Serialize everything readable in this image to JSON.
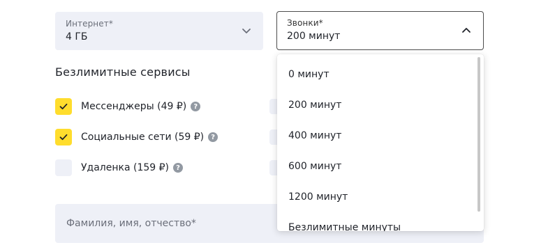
{
  "form": {
    "internet": {
      "label": "Интернет*",
      "value": "4 ГБ"
    },
    "calls": {
      "label": "Звонки*",
      "value": "200 минут"
    },
    "services_title": "Безлимитные сервисы",
    "services": [
      {
        "label": "Мессенджеры (49 ₽)",
        "checked": true
      },
      {
        "label": "Социальные сети (59 ₽)",
        "checked": true
      },
      {
        "label": "Удаленка (159 ₽)",
        "checked": false
      }
    ],
    "full_name_placeholder": "Фамилия, имя, отчество*"
  },
  "dropdown": {
    "options": [
      "0 минут",
      "200 минут",
      "400 минут",
      "600 минут",
      "1200 минут",
      "Безлимитные минуты"
    ]
  },
  "icons": {
    "help": "?",
    "check": "check-icon",
    "chevron_down": "chevron-down-icon",
    "chevron_up": "chevron-up-icon"
  },
  "colors": {
    "checkbox_checked": "#ffdd2d",
    "field_bg": "#eef0f7",
    "help_icon": "#9299a2"
  }
}
